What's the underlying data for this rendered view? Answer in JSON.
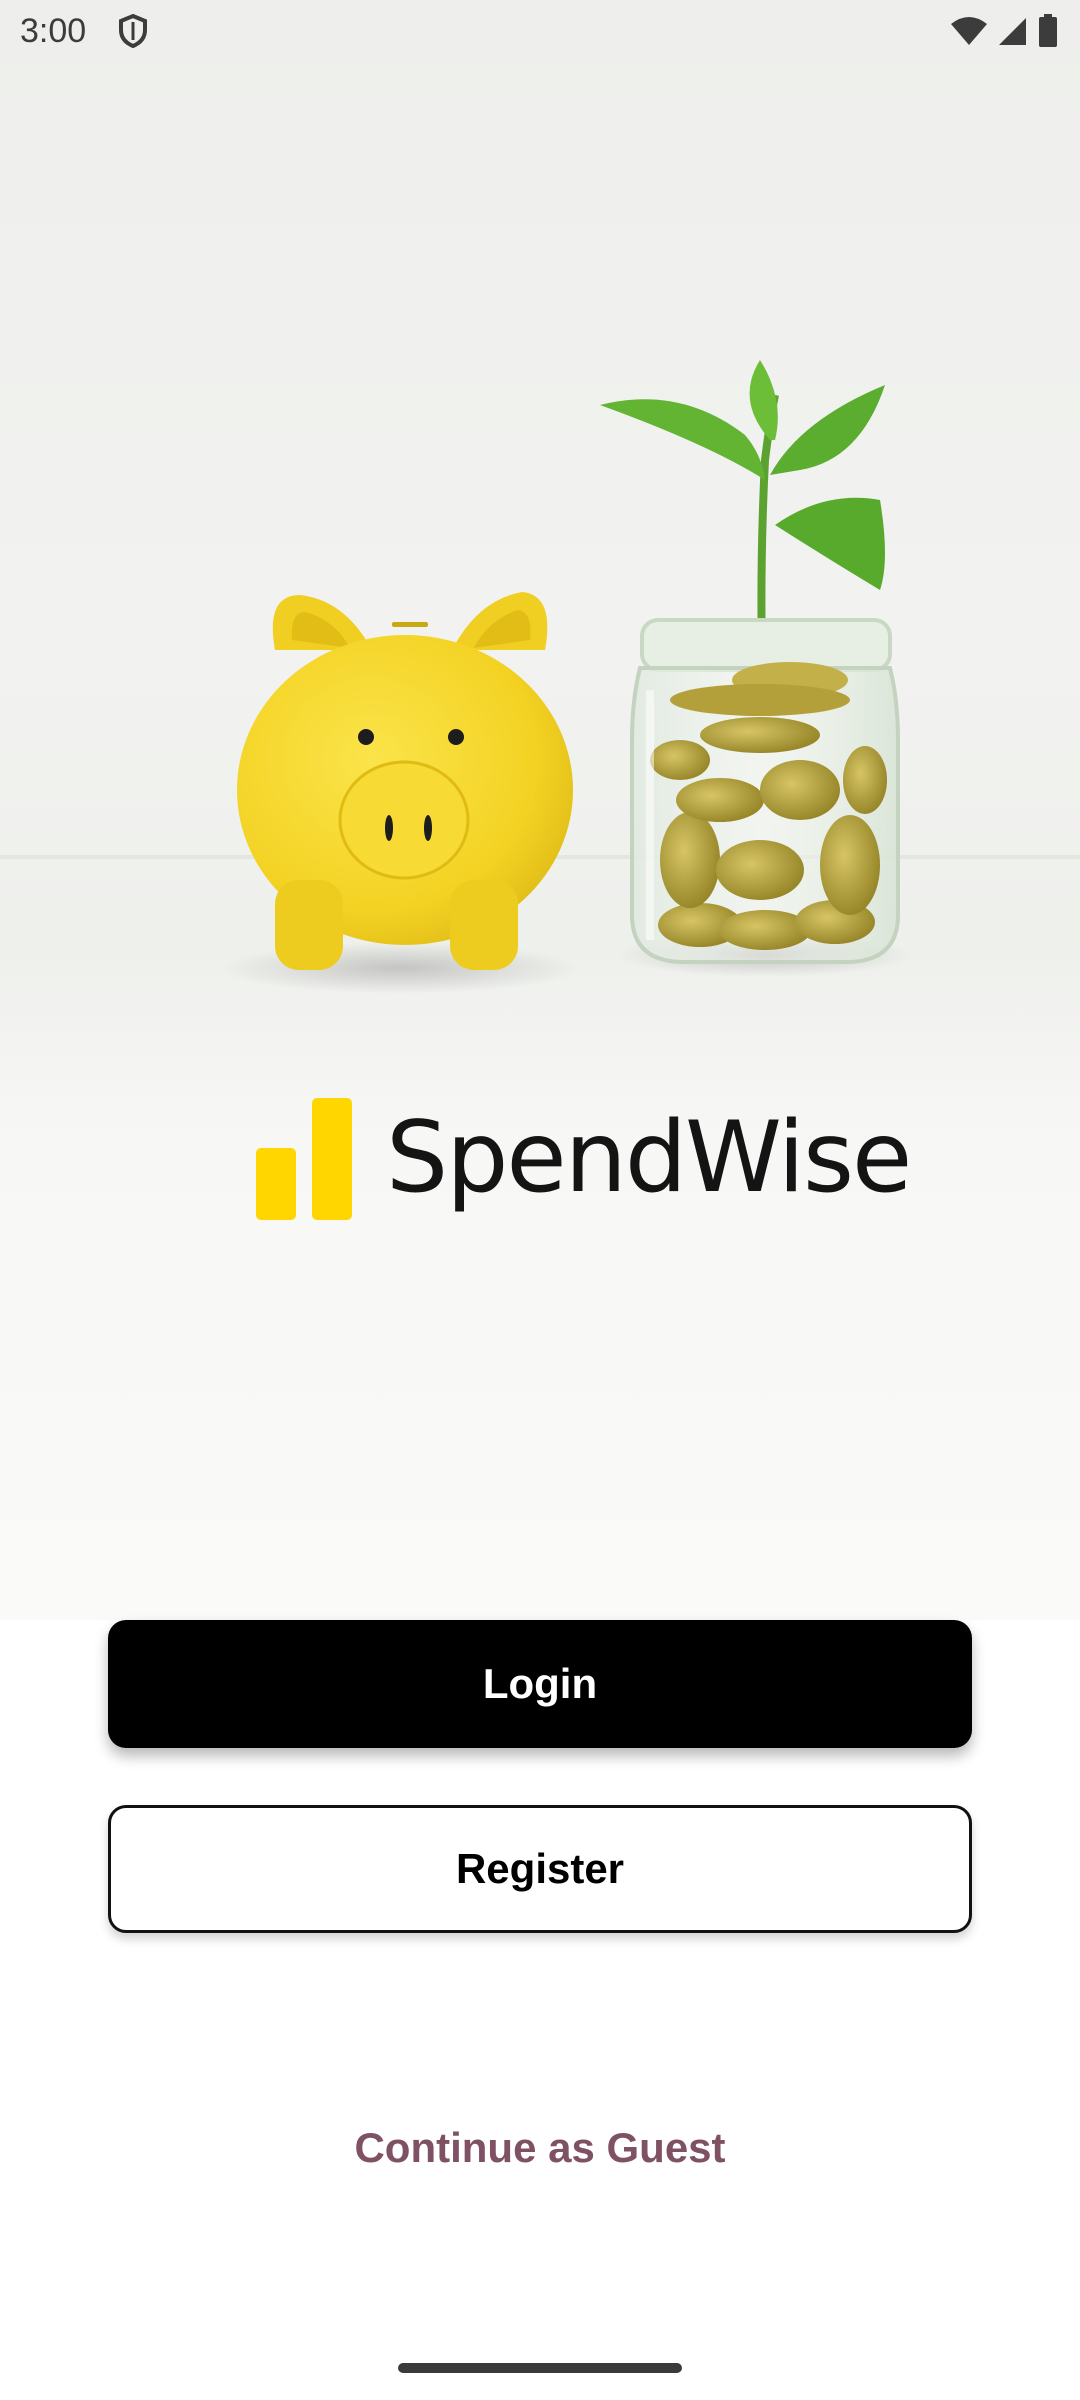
{
  "status_bar": {
    "time": "3:00",
    "left_icons": [
      "shield-icon"
    ],
    "right_icons": [
      "wifi-icon",
      "cellular-signal-icon",
      "battery-icon"
    ]
  },
  "hero": {
    "image": "piggy-bank-and-coin-jar-with-sprout",
    "colors": {
      "piggy": "#f5d52a",
      "leaf": "#5fb031",
      "coins": "#b6a23a"
    }
  },
  "brand": {
    "name": "SpendWise",
    "logo_icon": "bar-chart-logo-icon",
    "accent_color": "#ffd600"
  },
  "actions": {
    "login_label": "Login",
    "register_label": "Register",
    "guest_label": "Continue as Guest",
    "guest_color": "#7e5264"
  }
}
